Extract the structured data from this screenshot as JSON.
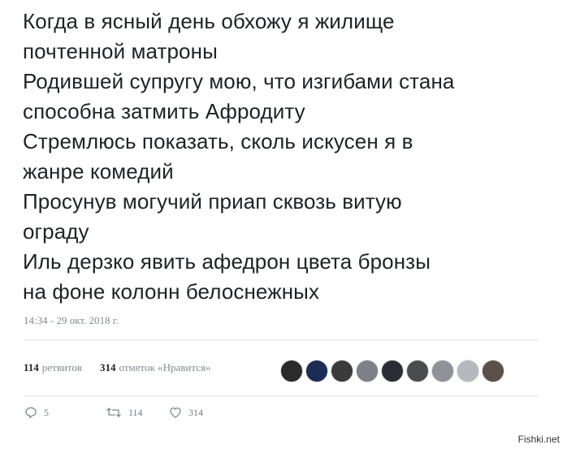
{
  "tweet": {
    "lines": [
      "Когда в ясный день обхожу я жилище",
      "почтенной матроны",
      "Родившей супругу мою, что изгибами стана",
      "способна затмить Афродиту",
      "Стремлюсь показать, сколь искусен я в",
      "жанре комедий",
      "Просунув могучий приап сквозь витую",
      "ограду",
      "Иль дерзко явить афедрон цвета бронзы",
      "на фоне колонн белоснежных"
    ],
    "timestamp": "14:34 - 29 окт. 2018 г."
  },
  "stats": {
    "retweets_count": "114",
    "retweets_label": "ретвитов",
    "likes_count": "314",
    "likes_label": "отметок «Нравится»"
  },
  "avatars": [
    {
      "color": "#2b2b2b"
    },
    {
      "color": "#1b2c55"
    },
    {
      "color": "#3a3a3a"
    },
    {
      "color": "#7d8086"
    },
    {
      "color": "#2c2c34"
    },
    {
      "color": "#4a4c50"
    },
    {
      "color": "#8f9398"
    },
    {
      "color": "#b5b8bc"
    },
    {
      "color": "#5a5048"
    }
  ],
  "actions": {
    "reply": {
      "icon": "reply-icon",
      "count": "5"
    },
    "retweet": {
      "icon": "retweet-icon",
      "count": "114"
    },
    "like": {
      "icon": "heart-icon",
      "count": "314"
    }
  },
  "watermark": "Fishki.net"
}
